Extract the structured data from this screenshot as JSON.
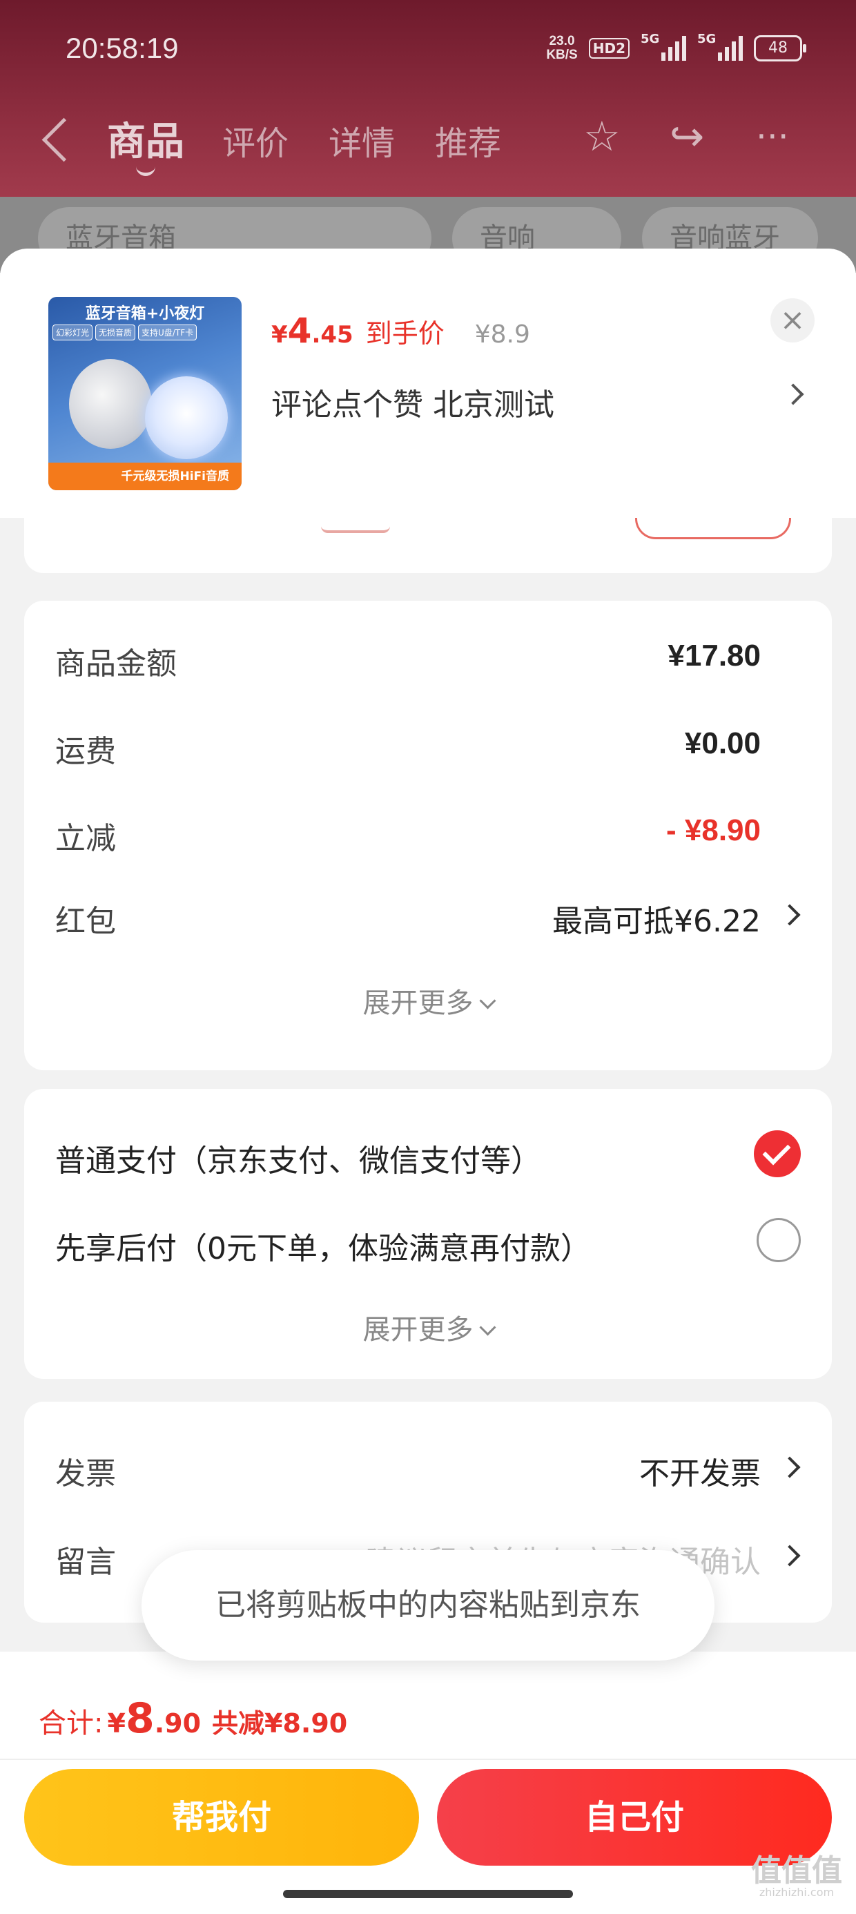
{
  "status_bar": {
    "time": "20:58:19",
    "speed_value": "23.0",
    "speed_unit": "KB/S",
    "hd": "HD2",
    "sig1": "5G",
    "sig2": "5G",
    "battery": "48"
  },
  "nav": {
    "tabs": [
      "商品",
      "评价",
      "详情",
      "推荐"
    ]
  },
  "background_chips": [
    "蓝牙音箱",
    "音响",
    "音响蓝牙"
  ],
  "product": {
    "price_symbol": "¥",
    "price_int": "4",
    "price_dec": ".45",
    "price_label": "到手价",
    "original_price": "¥8.9",
    "spec": "评论点个赞  北京测试",
    "image_title": "蓝牙音箱+小夜灯",
    "image_tags": [
      "幻彩灯光",
      "无损音质",
      "支持U盘/TF卡"
    ],
    "image_footer": "千元级无损HiFi音质"
  },
  "amounts": {
    "rows": [
      {
        "label": "商品金额",
        "value": "¥17.80"
      },
      {
        "label": "运费",
        "value": "¥0.00"
      },
      {
        "label": "立减",
        "value": "- ¥8.90"
      },
      {
        "label": "红包",
        "value": "最高可抵¥6.22"
      }
    ],
    "more": "展开更多"
  },
  "payment": {
    "options": [
      {
        "label": "普通支付（京东支付、微信支付等）",
        "selected": true
      },
      {
        "label": "先享后付（0元下单，体验满意再付款）",
        "selected": false
      }
    ],
    "more": "展开更多"
  },
  "extra": {
    "invoice_label": "发票",
    "invoice_value": "不开发票",
    "note_label": "留言",
    "note_placeholder": "建议留言前先与商家沟通确认"
  },
  "toast": "已将剪贴板中的内容粘贴到京东",
  "footer": {
    "total_label": "合计:",
    "total_symbol": "¥",
    "total_int": "8",
    "total_dec": ".90",
    "discount": "共减¥8.90",
    "help_pay": "帮我付",
    "self_pay": "自己付"
  },
  "watermark": {
    "main": "值值值",
    "sub": "zhizhizhi.com"
  },
  "colors": {
    "accent": "#e8322a",
    "help_button": "#ffb40a",
    "self_button": "#f5404a"
  }
}
